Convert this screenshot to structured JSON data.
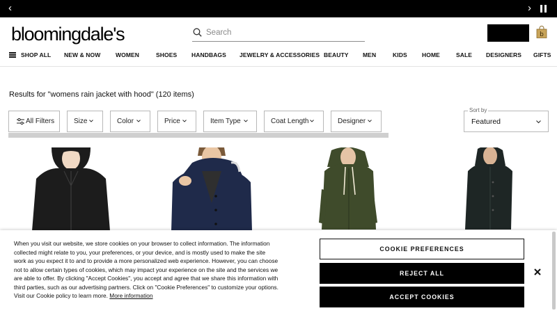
{
  "promo": {
    "prev_icon": "chevron-left-icon",
    "next_icon": "chevron-right-icon",
    "pause_icon": "pause-icon"
  },
  "header": {
    "logo": "bloomingdale's",
    "search_placeholder": "Search",
    "bag_icon": "shopping-bag-icon"
  },
  "nav": {
    "shop_all": "SHOP ALL",
    "items": [
      "NEW & NOW",
      "WOMEN",
      "SHOES",
      "HANDBAGS",
      "JEWELRY & ACCESSORIES",
      "BEAUTY",
      "MEN",
      "KIDS",
      "HOME",
      "SALE",
      "DESIGNERS",
      "GIFTS"
    ]
  },
  "results": {
    "text": "Results for \"womens rain jacket with hood\" (120 items)"
  },
  "filters": {
    "all_filters": "All Filters",
    "size": "Size",
    "color": "Color",
    "price": "Price",
    "item_type": "Item Type",
    "coat_length": "Coat Length",
    "designer": "Designer"
  },
  "sort": {
    "label": "Sort by",
    "value": "Featured"
  },
  "products": [
    {
      "name": "black-rain-jacket",
      "color": "#1c1c1c"
    },
    {
      "name": "navy-rain-jacket",
      "color": "#1f2a4a"
    },
    {
      "name": "olive-rain-jacket",
      "color": "#3f4b2b"
    },
    {
      "name": "dark-green-rain-coat",
      "color": "#1e2625"
    }
  ],
  "cookie": {
    "text": "When you visit our website, we store cookies on your browser to collect information. The information collected might relate to you, your preferences, or your device, and is mostly used to make the site work as you expect it to and to provide a more personalized web experience. However, you can choose not to allow certain types of cookies, which may impact your experience on the site and the services we are able to offer. By clicking \"Accept Cookies\", you accept and agree that we share this information with third parties, such as our advertising partners. Click on \"Cookie Preferences\" to customize your options. Visit our Cookie policy to learn more.",
    "more_info": "More information",
    "preferences": "COOKIE PREFERENCES",
    "reject": "REJECT ALL",
    "accept": "ACCEPT COOKIES"
  }
}
